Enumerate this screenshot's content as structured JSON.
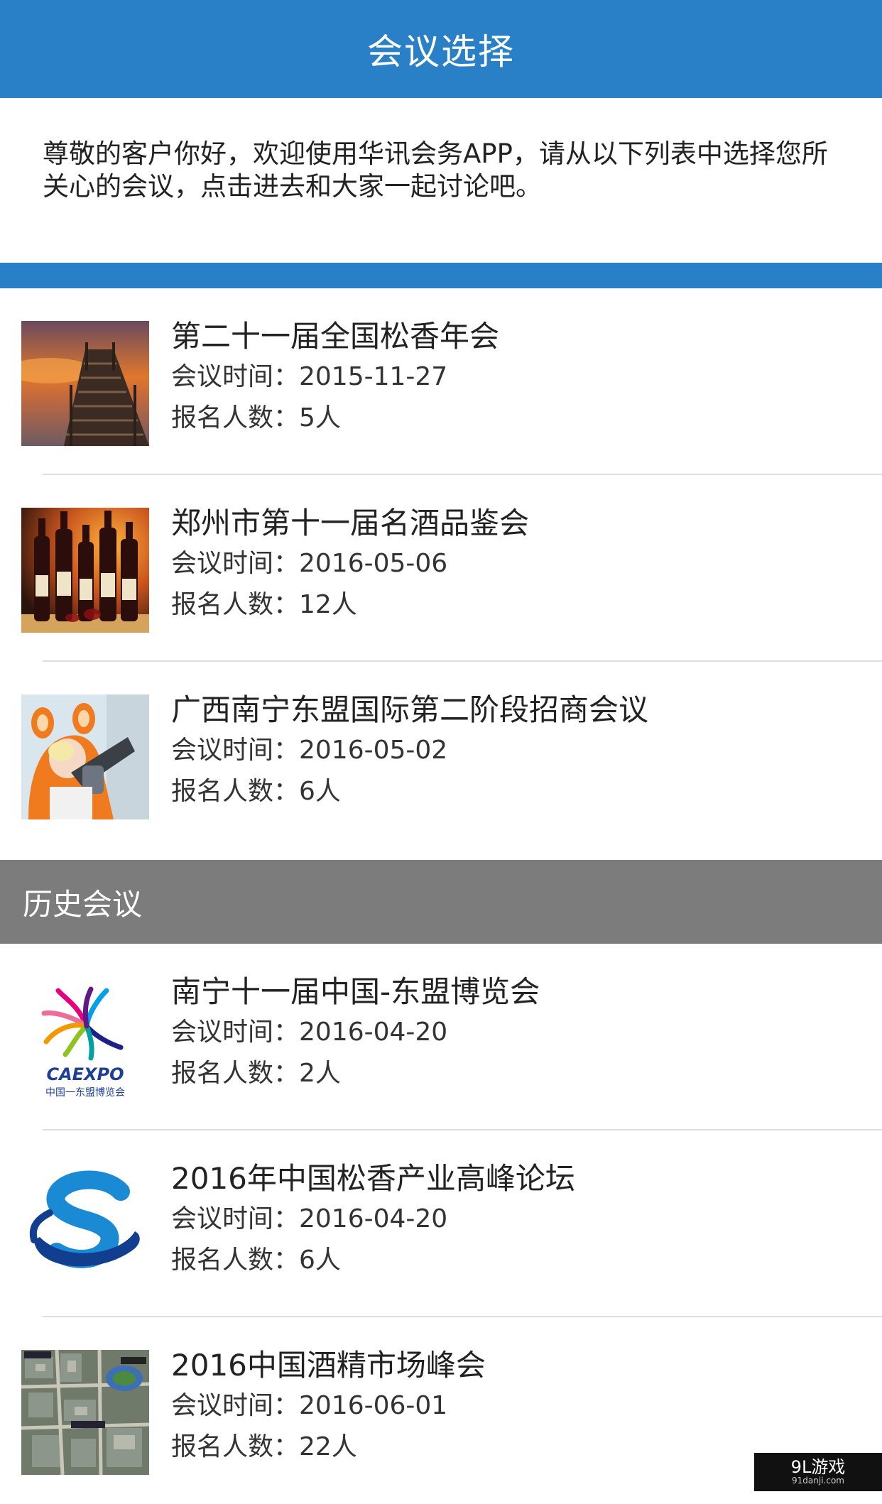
{
  "header": {
    "title": "会议选择"
  },
  "intro": {
    "text": "尊敬的客户你好，欢迎使用华讯会务APP，请从以下列表中选择您所关心的会议，点击进去和大家一起讨论吧。"
  },
  "current_meetings": [
    {
      "title": "第二十一届全国松香年会",
      "time": "会议时间：2015-11-27",
      "count": "报名人数：5人",
      "thumb_icon": "pier-sunset-photo"
    },
    {
      "title": "郑州市第十一届名酒品鉴会",
      "time": "会议时间：2016-05-06",
      "count": "报名人数：12人",
      "thumb_icon": "wine-bottles-photo"
    },
    {
      "title": "广西南宁东盟国际第二阶段招商会议",
      "time": "会议时间：2016-05-02",
      "count": "报名人数：6人",
      "thumb_icon": "orange-hood-girl-photo"
    }
  ],
  "history_section": {
    "title": "历史会议"
  },
  "history_meetings": [
    {
      "title": "南宁十一届中国-东盟博览会",
      "time": "会议时间：2016-04-20",
      "count": "报名人数：2人",
      "thumb_icon": "caexpo-logo",
      "logo_text": "CAEXPO",
      "logo_subtext": "中国一东盟博览会"
    },
    {
      "title": "2016年中国松香产业高峰论坛",
      "time": "会议时间：2016-04-20",
      "count": "报名人数：6人",
      "thumb_icon": "blue-s-orbit-logo"
    },
    {
      "title": "2016中国酒精市场峰会",
      "time": "会议时间：2016-06-01",
      "count": "报名人数：22人",
      "thumb_icon": "aerial-map-photo"
    }
  ],
  "watermark": {
    "text": "9L游戏",
    "subtext": "91danji.com"
  },
  "colors": {
    "primary": "#2a80c6",
    "history_header": "#7c7c7c",
    "divider": "#dedede"
  }
}
